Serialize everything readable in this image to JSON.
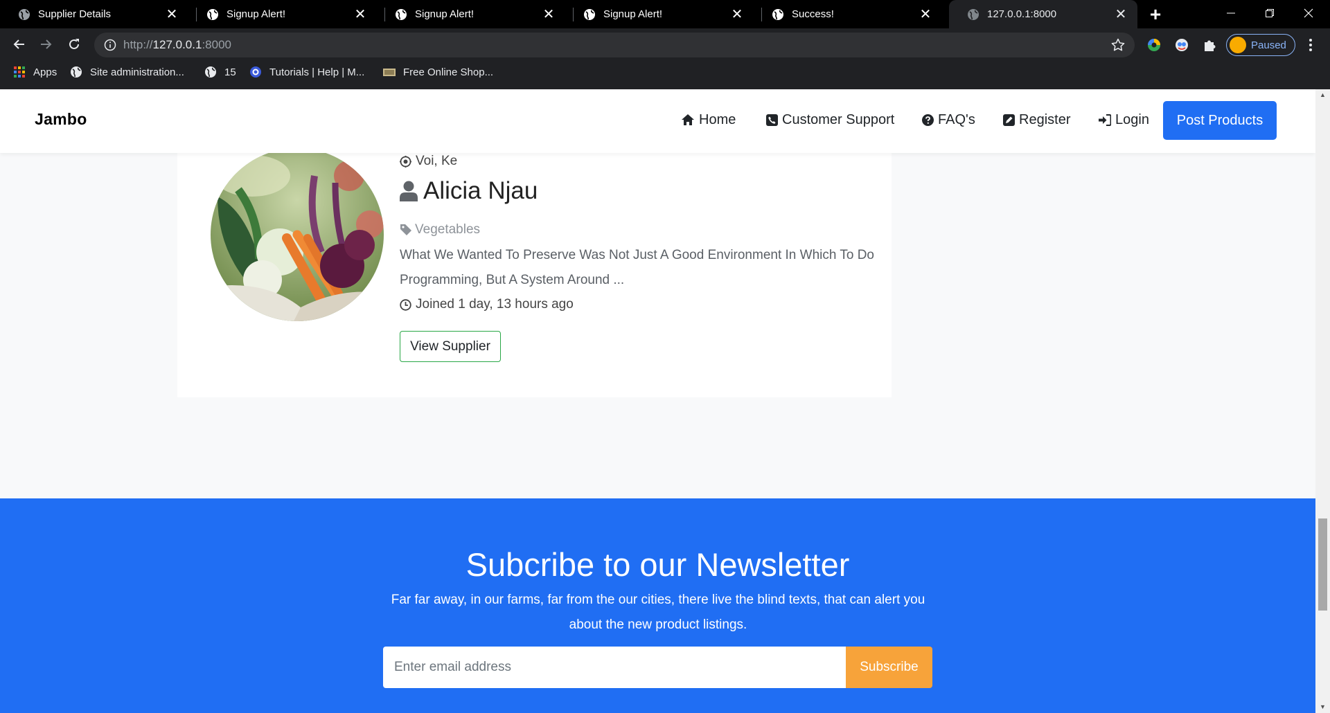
{
  "browser": {
    "tabs": [
      {
        "title": "Supplier Details",
        "active": false
      },
      {
        "title": "Signup Alert!",
        "active": false
      },
      {
        "title": "Signup Alert!",
        "active": false
      },
      {
        "title": "Signup Alert!",
        "active": false
      },
      {
        "title": "Success!",
        "active": false
      },
      {
        "title": "127.0.0.1:8000",
        "active": true
      }
    ],
    "url_scheme": "http://",
    "url_host": "127.0.0.1",
    "url_port": ":8000",
    "profile_label": "Paused",
    "bookmarks": [
      {
        "label": "Apps",
        "icon": "apps-grid-icon"
      },
      {
        "label": "Site administration...",
        "icon": "globe-icon"
      },
      {
        "label": "15",
        "icon": "globe-icon"
      },
      {
        "label": "Tutorials | Help | M...",
        "icon": "site-logo-icon"
      },
      {
        "label": "Free Online Shop...",
        "icon": "card-icon"
      }
    ]
  },
  "navbar": {
    "brand": "Jambo",
    "links": [
      {
        "label": "Home",
        "icon": "home-icon"
      },
      {
        "label": "Customer Support",
        "icon": "phone-square-icon"
      },
      {
        "label": "FAQ's",
        "icon": "question-circle-icon"
      },
      {
        "label": "Register",
        "icon": "edit-icon"
      },
      {
        "label": "Login",
        "icon": "sign-in-icon"
      }
    ],
    "cta": "Post Products"
  },
  "supplier": {
    "location": "Voi, Ke",
    "name": "Alicia Njau",
    "category": "Vegetables",
    "description": "What We Wanted To Preserve Was Not Just A Good Environment In Which To Do Programming, But A System Around ...",
    "joined": "Joined 1 day, 13 hours ago",
    "view_button": "View Supplier"
  },
  "newsletter": {
    "title": "Subcribe to our Newsletter",
    "text": "Far far away, in our farms, far from the our cities, there live the blind texts, that can alert you about the new product listings.",
    "placeholder": "Enter email address",
    "button": "Subscribe"
  },
  "colors": {
    "primary": "#206ef3",
    "subscribe": "#f7a33a",
    "view_border": "#28a745"
  }
}
